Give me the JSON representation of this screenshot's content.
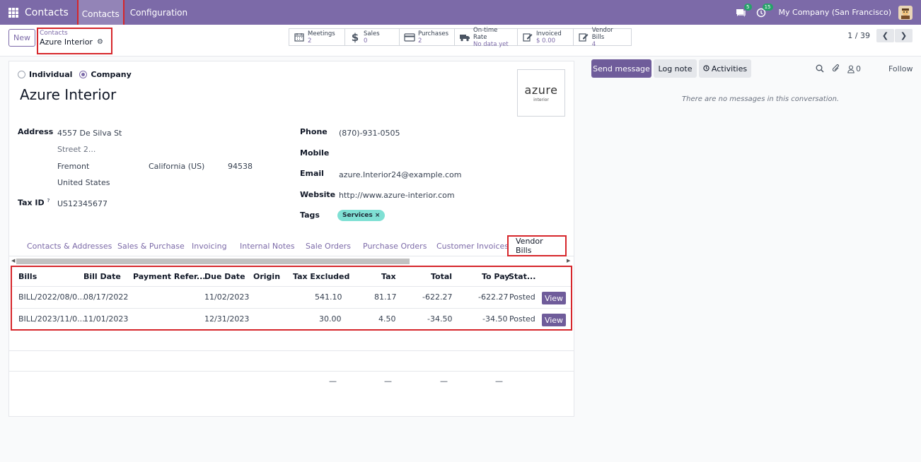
{
  "topbar": {
    "brand": "Contacts",
    "menus": [
      "Contacts",
      "Configuration"
    ],
    "messages_badge": "5",
    "activities_badge": "15",
    "company": "My Company (San Francisco)"
  },
  "control": {
    "new_label": "New",
    "breadcrumb_parent": "Contacts",
    "breadcrumb_current": "Azure Interior",
    "pager": "1 / 39",
    "smart_buttons": [
      {
        "label": "Meetings",
        "value": "2",
        "icon": "calendar-icon"
      },
      {
        "label": "Sales",
        "value": "0",
        "icon": "dollar-icon"
      },
      {
        "label": "Purchases",
        "value": "2",
        "icon": "credit-card-icon"
      },
      {
        "label": "On-time Rate",
        "value": "No data yet",
        "icon": "truck-icon"
      },
      {
        "label": "Invoiced",
        "value": "$ 0.00",
        "icon": "edit-icon"
      },
      {
        "label": "Vendor Bills",
        "value": "4",
        "icon": "edit-icon"
      }
    ]
  },
  "form": {
    "type_individual": "Individual",
    "type_company": "Company",
    "name": "Azure Interior",
    "logo_main": "azure",
    "logo_sub": "interior",
    "address_label": "Address",
    "street": "4557 De Silva St",
    "street2_placeholder": "Street 2...",
    "city": "Fremont",
    "state": "California (US)",
    "zip": "94538",
    "country": "United States",
    "taxid_label": "Tax ID",
    "taxid_help": "?",
    "taxid": "US12345677",
    "phone_label": "Phone",
    "phone": "(870)-931-0505",
    "mobile_label": "Mobile",
    "email_label": "Email",
    "email": "azure.Interior24@example.com",
    "website_label": "Website",
    "website": "http://www.azure-interior.com",
    "tags_label": "Tags",
    "tag": "Services",
    "tag_remove": "×"
  },
  "tabs": [
    "Contacts & Addresses",
    "Sales & Purchase",
    "Invoicing",
    "Internal Notes",
    "Sale Orders",
    "Purchase Orders",
    "Customer Invoices",
    "Vendor Bills"
  ],
  "bills": {
    "headers": [
      "Bills",
      "Bill Date",
      "Payment Refer...",
      "Due Date",
      "Origin",
      "Tax Excluded",
      "Tax",
      "Total",
      "To Pay",
      "Stat..."
    ],
    "rows": [
      {
        "bill": "BILL/2022/08/0...",
        "date": "08/17/2022",
        "ref": "",
        "due": "11/02/2023",
        "origin": "",
        "tax_excl": "541.10",
        "tax": "81.17",
        "total": "-622.27",
        "to_pay": "-622.27",
        "status": "Posted",
        "action": "View"
      },
      {
        "bill": "BILL/2023/11/0...",
        "date": "11/01/2023",
        "ref": "",
        "due": "12/31/2023",
        "origin": "",
        "tax_excl": "30.00",
        "tax": "4.50",
        "total": "-34.50",
        "to_pay": "-34.50",
        "status": "Posted",
        "action": "View"
      }
    ],
    "footer_dash": "—"
  },
  "chatter": {
    "send": "Send message",
    "log": "Log note",
    "activities": "Activities",
    "followers_count": "0",
    "follow": "Follow",
    "no_messages": "There are no messages in this conversation."
  },
  "colors": {
    "primary": "#7c6aa8",
    "highlight": "#d6262b",
    "tag": "#7fe0d4"
  }
}
